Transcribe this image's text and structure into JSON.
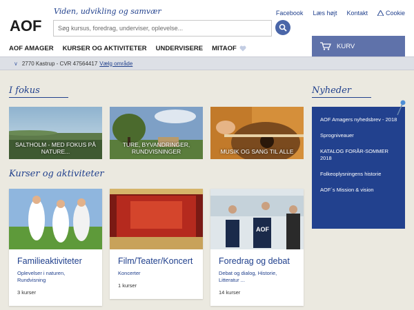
{
  "header": {
    "logo_text": "AOF",
    "tagline": "Viden, udvikling og samvær",
    "search_placeholder": "Søg kursus, foredrag, underviser, oplevelse...",
    "top_links": [
      "Facebook",
      "Læs højt",
      "Kontakt",
      "Cookie"
    ],
    "nav": [
      "AOF AMAGER",
      "KURSER OG AKTIVITETER",
      "UNDERVISERE",
      "MITAOF"
    ],
    "cart_label": "KURV"
  },
  "location": {
    "text": "2770 Kastrup - CVR 47564417",
    "link": "Vælg område"
  },
  "focus": {
    "heading": "I fokus",
    "tiles": [
      "SALTHOLM - MED FOKUS PÅ NATURE...",
      "TURE, BYVANDRINGER, RUNDVISNINGER",
      "MUSIK OG SANG TIL ALLE"
    ]
  },
  "courses": {
    "heading": "Kurser og aktiviteter",
    "cards": [
      {
        "title": "Familieaktiviteter",
        "desc": "Oplevelser i naturen, Rundvisning",
        "count": "3 kurser"
      },
      {
        "title": "Film/Teater/Koncert",
        "desc": "Koncerter",
        "count": "1 kurser"
      },
      {
        "title": "Foredrag og debat",
        "desc": "Debat og dialog, Historie, Litteratur ...",
        "count": "14 kurser"
      }
    ]
  },
  "news": {
    "heading": "Nyheder",
    "items": [
      "AOF Amagers nyhedsbrev - 2018",
      "Sprogniveauer",
      "KATALOG FORÅR-SOMMER 2018",
      "Folkeoplysningens historie",
      "AOF´s Mission & vision"
    ]
  }
}
